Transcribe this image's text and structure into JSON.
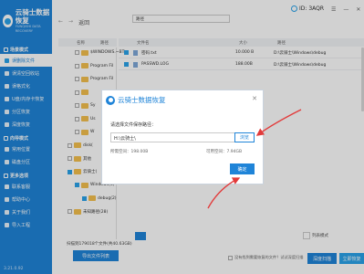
{
  "brand": {
    "title": "云骑士数据恢复",
    "subtitle": "YUNQISHI DATA RECOVERY"
  },
  "sidebar": {
    "sections": [
      {
        "label": "场景模式",
        "items": [
          {
            "label": "误删除文件",
            "active": true
          },
          {
            "label": "误清空回收站"
          },
          {
            "label": "误格式化"
          },
          {
            "label": "U盘/内存卡恢复"
          },
          {
            "label": "分区恢复"
          },
          {
            "label": "深度恢复"
          }
        ]
      },
      {
        "label": "向导模式",
        "items": [
          {
            "label": "常用位置"
          },
          {
            "label": "磁盘分区"
          }
        ]
      },
      {
        "label": "更多选项",
        "items": [
          {
            "label": "联系客服"
          },
          {
            "label": "帮助中心"
          },
          {
            "label": "关于我们"
          },
          {
            "label": "导入工程"
          }
        ]
      }
    ],
    "version": "3.21.0.92"
  },
  "topbar": {
    "back_label": "返回",
    "search_value": "路径",
    "id_label": "ID: 3AQR"
  },
  "tree": {
    "headers": [
      "名称",
      "路径"
    ],
    "rows": [
      {
        "name": "$WINDOWS.~BT",
        "checked": false,
        "indent": 2
      },
      {
        "name": "Program Fil",
        "checked": false,
        "indent": 2
      },
      {
        "name": "Program Fil",
        "checked": false,
        "indent": 2
      },
      {
        "name": "",
        "checked": false,
        "indent": 2
      },
      {
        "name": "Sy",
        "checked": false,
        "indent": 2
      },
      {
        "name": "Us",
        "checked": false,
        "indent": 2
      },
      {
        "name": "W",
        "checked": false,
        "indent": 2
      },
      {
        "name": "disk(",
        "checked": false,
        "indent": 1
      },
      {
        "name": "其他",
        "checked": false,
        "indent": 1
      },
      {
        "name": "云骑士(",
        "checked": true,
        "indent": 1
      },
      {
        "name": "Windows(3)",
        "checked": true,
        "indent": 2
      },
      {
        "name": "debug(2)",
        "checked": true,
        "indent": 3
      },
      {
        "name": "未知路径(28)",
        "checked": false,
        "indent": 1
      }
    ]
  },
  "files": {
    "headers": [
      "文件名",
      "大小",
      "路径"
    ],
    "rows": [
      {
        "name": "密码.txt",
        "size": "10.000 B",
        "path": "D:\\云骑士\\Windows\\debug",
        "checked": true
      },
      {
        "name": "PASSWD.LOG",
        "size": "188.00B",
        "path": "D:\\云骑士\\Windows\\debug",
        "checked": true
      }
    ]
  },
  "bottom": {
    "status": "扫描到179018个文件(共40.63GB)",
    "export_label": "导出文件列表",
    "list_mode_label": "列表模式",
    "deep_scan_note": "没有找到需要恢复的文件？试试深度扫描",
    "scan_label": "深度扫描",
    "recover_label": "立即恢复"
  },
  "dialog": {
    "title": "云骑士数据恢复",
    "prompt": "请选择文件保存路径：",
    "path_value": "H:\\云骑士\\",
    "browse_label": "浏览",
    "need_space": "所需空间：198.00B",
    "free_space": "可用空间：7.94GB",
    "ok_label": "确定"
  },
  "colors": {
    "accent": "#1f84d8",
    "light_accent": "#2aa3ea",
    "arrow": "#e23b3b"
  }
}
